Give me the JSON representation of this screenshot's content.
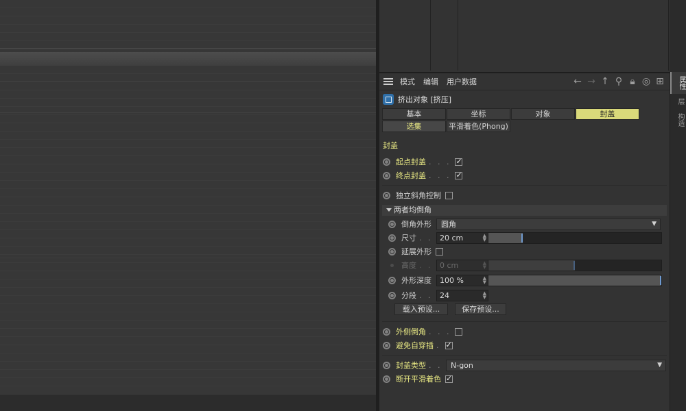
{
  "menubar": {
    "items": [
      "模式",
      "编辑",
      "用户数据"
    ],
    "icons": [
      "arrow-left-icon",
      "arrow-right-icon",
      "arrow-up-icon",
      "search-icon",
      "lock-icon",
      "target-icon",
      "add-panel-icon"
    ]
  },
  "object": {
    "title": "挤出对象 [挤压]"
  },
  "tabs_row1": [
    "基本",
    "坐标",
    "对象",
    "封盖"
  ],
  "tabs_row2": [
    "选集",
    "平滑着色(Phong)"
  ],
  "section_title": "封盖",
  "params": {
    "start_cap": {
      "label": "起点封盖",
      "dots": ". . .",
      "checked": true
    },
    "end_cap": {
      "label": "终点封盖",
      "dots": ". . .",
      "checked": true
    },
    "separate_bevel": {
      "label": "独立斜角控制",
      "checked": false
    }
  },
  "group": {
    "title": "两者均倒角",
    "shape": {
      "label": "倒角外形",
      "value": "圆角"
    },
    "size": {
      "label": "尺寸",
      "dots": ". . .",
      "value": "20 cm",
      "slider": 0.2
    },
    "extend": {
      "label": "延展外形",
      "checked": false
    },
    "height": {
      "label": "高度",
      "dots": ". . .",
      "value": "0 cm",
      "slider": 0.5
    },
    "depth": {
      "label": "外形深度",
      "value": "100 %",
      "slider": 1.0
    },
    "segments": {
      "label": "分段",
      "dots": ". . .",
      "value": "24"
    },
    "load_preset": "载入预设...",
    "save_preset": "保存预设..."
  },
  "params2": {
    "outer_bevel": {
      "label": "外侧倒角",
      "dots": ". . .",
      "checked": false
    },
    "avoid_self": {
      "label": "避免自穿插",
      "dots": ".",
      "checked": true
    }
  },
  "params3": {
    "cap_type": {
      "label": "封盖类型",
      "dots": ". .",
      "value": "N-gon"
    },
    "break_phong": {
      "label": "断开平滑着色",
      "checked": true
    }
  },
  "side_tabs": [
    "属性",
    "层",
    "构造"
  ]
}
